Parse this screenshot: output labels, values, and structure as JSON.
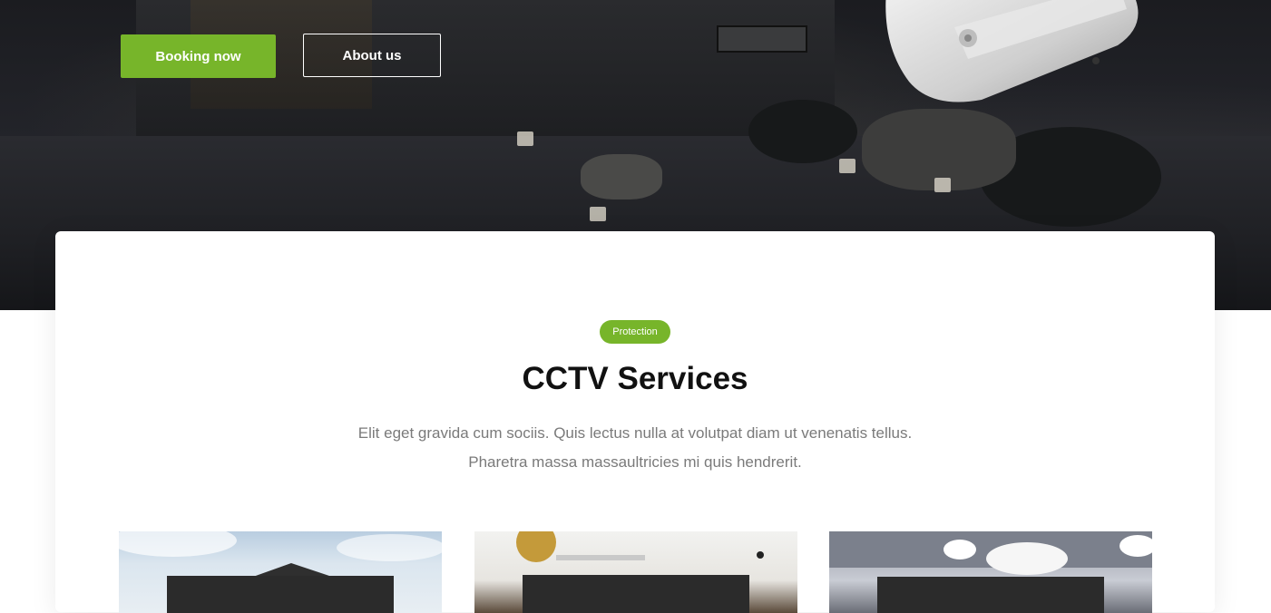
{
  "hero": {
    "buttons": {
      "booking": "Booking now",
      "about": "About us"
    }
  },
  "services": {
    "badge": "Protection",
    "title": "CCTV Services",
    "description_lines": [
      "Elit eget gravida cum sociis. Quis lectus nulla at volutpat diam ut venenatis tellus.",
      "Pharetra massa massaultricies mi quis hendrerit."
    ]
  },
  "colors": {
    "accent": "#77b52a",
    "hero_bg": "#1b1c20",
    "title": "#111111",
    "muted_text": "#7a7a7a"
  }
}
